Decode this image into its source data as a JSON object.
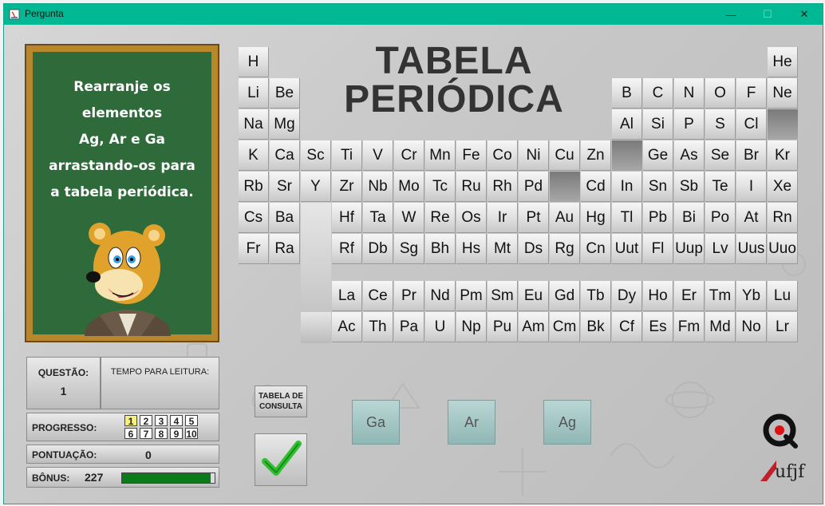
{
  "window": {
    "title": "Pergunta",
    "minimize": "—",
    "maximize": "☐",
    "close": "✕"
  },
  "board": {
    "instruction": "Rearranje os\nelementos\nAg, Ar e Ga\narrastando-os para\na tabela periódica."
  },
  "table_title": [
    "TABELA",
    "PERIÓDICA"
  ],
  "elements": [
    {
      "s": "H",
      "r": 0,
      "c": 0
    },
    {
      "s": "He",
      "r": 0,
      "c": 17
    },
    {
      "s": "Li",
      "r": 1,
      "c": 0
    },
    {
      "s": "Be",
      "r": 1,
      "c": 1
    },
    {
      "s": "B",
      "r": 1,
      "c": 12
    },
    {
      "s": "C",
      "r": 1,
      "c": 13
    },
    {
      "s": "N",
      "r": 1,
      "c": 14
    },
    {
      "s": "O",
      "r": 1,
      "c": 15
    },
    {
      "s": "F",
      "r": 1,
      "c": 16
    },
    {
      "s": "Ne",
      "r": 1,
      "c": 17
    },
    {
      "s": "Na",
      "r": 2,
      "c": 0
    },
    {
      "s": "Mg",
      "r": 2,
      "c": 1
    },
    {
      "s": "Al",
      "r": 2,
      "c": 12
    },
    {
      "s": "Si",
      "r": 2,
      "c": 13
    },
    {
      "s": "P",
      "r": 2,
      "c": 14
    },
    {
      "s": "S",
      "r": 2,
      "c": 15
    },
    {
      "s": "Cl",
      "r": 2,
      "c": 16
    },
    {
      "s": "K",
      "r": 3,
      "c": 0
    },
    {
      "s": "Ca",
      "r": 3,
      "c": 1
    },
    {
      "s": "Sc",
      "r": 3,
      "c": 2
    },
    {
      "s": "Ti",
      "r": 3,
      "c": 3
    },
    {
      "s": "V",
      "r": 3,
      "c": 4
    },
    {
      "s": "Cr",
      "r": 3,
      "c": 5
    },
    {
      "s": "Mn",
      "r": 3,
      "c": 6
    },
    {
      "s": "Fe",
      "r": 3,
      "c": 7
    },
    {
      "s": "Co",
      "r": 3,
      "c": 8
    },
    {
      "s": "Ni",
      "r": 3,
      "c": 9
    },
    {
      "s": "Cu",
      "r": 3,
      "c": 10
    },
    {
      "s": "Zn",
      "r": 3,
      "c": 11
    },
    {
      "s": "Ge",
      "r": 3,
      "c": 13
    },
    {
      "s": "As",
      "r": 3,
      "c": 14
    },
    {
      "s": "Se",
      "r": 3,
      "c": 15
    },
    {
      "s": "Br",
      "r": 3,
      "c": 16
    },
    {
      "s": "Kr",
      "r": 3,
      "c": 17
    },
    {
      "s": "Rb",
      "r": 4,
      "c": 0
    },
    {
      "s": "Sr",
      "r": 4,
      "c": 1
    },
    {
      "s": "Y",
      "r": 4,
      "c": 2
    },
    {
      "s": "Zr",
      "r": 4,
      "c": 3
    },
    {
      "s": "Nb",
      "r": 4,
      "c": 4
    },
    {
      "s": "Mo",
      "r": 4,
      "c": 5
    },
    {
      "s": "Tc",
      "r": 4,
      "c": 6
    },
    {
      "s": "Ru",
      "r": 4,
      "c": 7
    },
    {
      "s": "Rh",
      "r": 4,
      "c": 8
    },
    {
      "s": "Pd",
      "r": 4,
      "c": 9
    },
    {
      "s": "Cd",
      "r": 4,
      "c": 11
    },
    {
      "s": "In",
      "r": 4,
      "c": 12
    },
    {
      "s": "Sn",
      "r": 4,
      "c": 13
    },
    {
      "s": "Sb",
      "r": 4,
      "c": 14
    },
    {
      "s": "Te",
      "r": 4,
      "c": 15
    },
    {
      "s": "I",
      "r": 4,
      "c": 16
    },
    {
      "s": "Xe",
      "r": 4,
      "c": 17
    },
    {
      "s": "Cs",
      "r": 5,
      "c": 0
    },
    {
      "s": "Ba",
      "r": 5,
      "c": 1
    },
    {
      "s": "Hf",
      "r": 5,
      "c": 3
    },
    {
      "s": "Ta",
      "r": 5,
      "c": 4
    },
    {
      "s": "W",
      "r": 5,
      "c": 5
    },
    {
      "s": "Re",
      "r": 5,
      "c": 6
    },
    {
      "s": "Os",
      "r": 5,
      "c": 7
    },
    {
      "s": "Ir",
      "r": 5,
      "c": 8
    },
    {
      "s": "Pt",
      "r": 5,
      "c": 9
    },
    {
      "s": "Au",
      "r": 5,
      "c": 10
    },
    {
      "s": "Hg",
      "r": 5,
      "c": 11
    },
    {
      "s": "Tl",
      "r": 5,
      "c": 12
    },
    {
      "s": "Pb",
      "r": 5,
      "c": 13
    },
    {
      "s": "Bi",
      "r": 5,
      "c": 14
    },
    {
      "s": "Po",
      "r": 5,
      "c": 15
    },
    {
      "s": "At",
      "r": 5,
      "c": 16
    },
    {
      "s": "Rn",
      "r": 5,
      "c": 17
    },
    {
      "s": "Fr",
      "r": 6,
      "c": 0
    },
    {
      "s": "Ra",
      "r": 6,
      "c": 1
    },
    {
      "s": "Rf",
      "r": 6,
      "c": 3
    },
    {
      "s": "Db",
      "r": 6,
      "c": 4
    },
    {
      "s": "Sg",
      "r": 6,
      "c": 5
    },
    {
      "s": "Bh",
      "r": 6,
      "c": 6
    },
    {
      "s": "Hs",
      "r": 6,
      "c": 7
    },
    {
      "s": "Mt",
      "r": 6,
      "c": 8
    },
    {
      "s": "Ds",
      "r": 6,
      "c": 9
    },
    {
      "s": "Rg",
      "r": 6,
      "c": 10
    },
    {
      "s": "Cn",
      "r": 6,
      "c": 11
    },
    {
      "s": "Uut",
      "r": 6,
      "c": 12
    },
    {
      "s": "Fl",
      "r": 6,
      "c": 13
    },
    {
      "s": "Uup",
      "r": 6,
      "c": 14
    },
    {
      "s": "Lv",
      "r": 6,
      "c": 15
    },
    {
      "s": "Uus",
      "r": 6,
      "c": 16
    },
    {
      "s": "Uuo",
      "r": 6,
      "c": 17
    },
    {
      "s": "La",
      "r": 7,
      "c": 3
    },
    {
      "s": "Ce",
      "r": 7,
      "c": 4
    },
    {
      "s": "Pr",
      "r": 7,
      "c": 5
    },
    {
      "s": "Nd",
      "r": 7,
      "c": 6
    },
    {
      "s": "Pm",
      "r": 7,
      "c": 7
    },
    {
      "s": "Sm",
      "r": 7,
      "c": 8
    },
    {
      "s": "Eu",
      "r": 7,
      "c": 9
    },
    {
      "s": "Gd",
      "r": 7,
      "c": 10
    },
    {
      "s": "Tb",
      "r": 7,
      "c": 11
    },
    {
      "s": "Dy",
      "r": 7,
      "c": 12
    },
    {
      "s": "Ho",
      "r": 7,
      "c": 13
    },
    {
      "s": "Er",
      "r": 7,
      "c": 14
    },
    {
      "s": "Tm",
      "r": 7,
      "c": 15
    },
    {
      "s": "Yb",
      "r": 7,
      "c": 16
    },
    {
      "s": "Lu",
      "r": 7,
      "c": 17
    },
    {
      "s": "Ac",
      "r": 8,
      "c": 3
    },
    {
      "s": "Th",
      "r": 8,
      "c": 4
    },
    {
      "s": "Pa",
      "r": 8,
      "c": 5
    },
    {
      "s": "U",
      "r": 8,
      "c": 6
    },
    {
      "s": "Np",
      "r": 8,
      "c": 7
    },
    {
      "s": "Pu",
      "r": 8,
      "c": 8
    },
    {
      "s": "Am",
      "r": 8,
      "c": 9
    },
    {
      "s": "Cm",
      "r": 8,
      "c": 10
    },
    {
      "s": "Bk",
      "r": 8,
      "c": 11
    },
    {
      "s": "Cf",
      "r": 8,
      "c": 12
    },
    {
      "s": "Es",
      "r": 8,
      "c": 13
    },
    {
      "s": "Fm",
      "r": 8,
      "c": 14
    },
    {
      "s": "Md",
      "r": 8,
      "c": 15
    },
    {
      "s": "No",
      "r": 8,
      "c": 16
    },
    {
      "s": "Lr",
      "r": 8,
      "c": 17
    }
  ],
  "empty_slots": [
    {
      "r": 2,
      "c": 17,
      "for": "Ar"
    },
    {
      "r": 3,
      "c": 12,
      "for": "Ga"
    },
    {
      "r": 4,
      "c": 10,
      "for": "Ag"
    }
  ],
  "stats": {
    "question_label": "QUESTÃO:",
    "question_value": "1",
    "reading_time_label": "TEMPO PARA LEITURA:",
    "reading_time_value": "",
    "progress_label": "PROGRESSO:",
    "progress_steps": [
      "1",
      "2",
      "3",
      "4",
      "5",
      "6",
      "7",
      "8",
      "9",
      "10"
    ],
    "progress_current": 1,
    "score_label": "PONTUAÇÃO:",
    "score_value": "0",
    "bonus_label": "BÔNUS:",
    "bonus_value": "227",
    "bonus_fill_fraction": 0.96,
    "bonus_color": "#0b7a1a"
  },
  "consult_button": "TABELA DE\nCONSULTA",
  "confirm_icon": "check-icon",
  "draggables": [
    "Ga",
    "Ar",
    "Ag"
  ],
  "logo_text": "ufjf",
  "colors": {
    "titlebar": "#00b894",
    "board": "#2f6b3a",
    "frame": "#b8862b",
    "check": "#2fbf2f"
  }
}
